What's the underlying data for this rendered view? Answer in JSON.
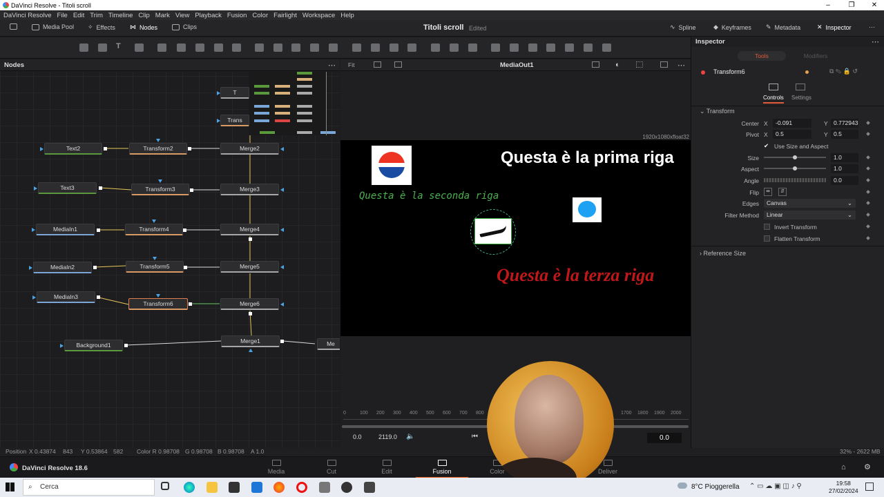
{
  "window": {
    "title": "DaVinci Resolve - Titoli scroll"
  },
  "menu": [
    "DaVinci Resolve",
    "File",
    "Edit",
    "Trim",
    "Timeline",
    "Clip",
    "Mark",
    "View",
    "Playback",
    "Fusion",
    "Color",
    "Fairlight",
    "Workspace",
    "Help"
  ],
  "toolbar": {
    "media_pool": "Media Pool",
    "effects": "Effects",
    "nodes": "Nodes",
    "clips": "Clips",
    "project_title": "Titoli scroll",
    "project_status": "Edited",
    "spline": "Spline",
    "keyframes": "Keyframes",
    "metadata": "Metadata",
    "inspector": "Inspector"
  },
  "nodes_panel": {
    "title": "Nodes",
    "nodes": {
      "text2": "Text2",
      "text3": "Text3",
      "mediain1": "MediaIn1",
      "mediain2": "MediaIn2",
      "mediain3": "MediaIn3",
      "background1": "Background1",
      "transform2": "Transform2",
      "transform3": "Transform3",
      "transform4": "Transform4",
      "transform5": "Transform5",
      "transform6": "Transform6",
      "merge2": "Merge2",
      "merge3": "Merge3",
      "merge4": "Merge4",
      "merge5": "Merge5",
      "merge6": "Merge6",
      "merge1": "Merge1",
      "t_top": "T",
      "trans_top": "Trans",
      "me": "Me"
    }
  },
  "viewer": {
    "fit": "Fit",
    "title": "MediaOut1",
    "resolution": "1920x1080xfloat32",
    "line1": "Questa è la prima riga",
    "line2": "Questa è la seconda riga",
    "line3": "Questa è la terza riga",
    "ruler": [
      "0",
      "100",
      "200",
      "300",
      "400",
      "500",
      "600",
      "700",
      "800",
      "1700",
      "1800",
      "1900",
      "2000"
    ],
    "tc_start": "0.0",
    "tc_end": "2119.0",
    "tc_current": "0.0"
  },
  "inspector": {
    "title": "Inspector",
    "tabs": {
      "tools": "Tools",
      "modifiers": "Modifiers"
    },
    "node_name": "Transform6",
    "subtabs": {
      "controls": "Controls",
      "settings": "Settings"
    },
    "section": "Transform",
    "center": {
      "label": "Center",
      "x_label": "X",
      "x": "-0.091",
      "y_label": "Y",
      "y": "0.772943"
    },
    "pivot": {
      "label": "Pivot",
      "x_label": "X",
      "x": "0.5",
      "y_label": "Y",
      "y": "0.5"
    },
    "use_size_aspect": "Use Size and Aspect",
    "size": {
      "label": "Size",
      "value": "1.0"
    },
    "aspect": {
      "label": "Aspect",
      "value": "1.0"
    },
    "angle": {
      "label": "Angle",
      "value": "0.0"
    },
    "flip": {
      "label": "Flip"
    },
    "edges": {
      "label": "Edges",
      "value": "Canvas"
    },
    "filter": {
      "label": "Filter Method",
      "value": "Linear"
    },
    "invert": "Invert Transform",
    "flatten": "Flatten Transform",
    "reference": "Reference Size"
  },
  "status": {
    "position": "Position",
    "pos_x": "X 0.43874",
    "pos_xp": "843",
    "pos_y": "Y 0.53864",
    "pos_yp": "582",
    "color": "Color R 0.98708",
    "g": "G 0.98708",
    "b": "B 0.98708",
    "a": "A 1.0",
    "memory": "32% - 2622 MB"
  },
  "pages": {
    "brand": "DaVinci Resolve 18.6",
    "media": "Media",
    "cut": "Cut",
    "edit": "Edit",
    "fusion": "Fusion",
    "color": "Color",
    "deliver": "Deliver"
  },
  "taskbar": {
    "search": "Cerca",
    "weather": "8°C Pioggerella",
    "time": "19:58",
    "date": "27/02/2024"
  }
}
